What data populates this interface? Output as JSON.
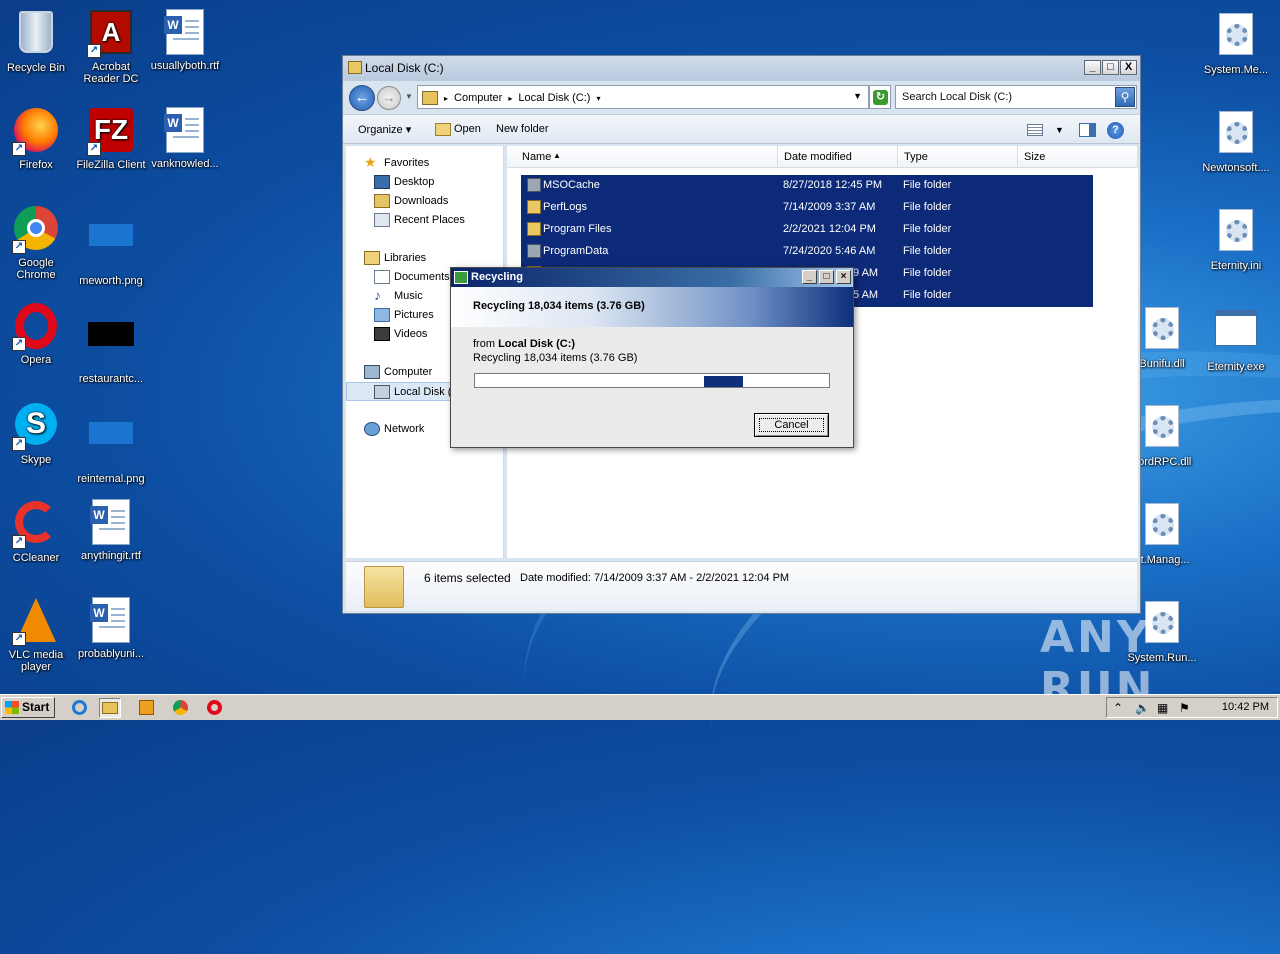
{
  "desktop": {
    "left_icons": [
      {
        "label": "Recycle Bin",
        "icon": "recycle-bin-icon"
      },
      {
        "label": "Acrobat\nReader DC",
        "icon": "acrobat-icon"
      },
      {
        "label": "usuallyboth.rtf",
        "icon": "word-doc-icon"
      },
      {
        "label": "Firefox",
        "icon": "firefox-icon"
      },
      {
        "label": "FileZilla Client",
        "icon": "filezilla-icon"
      },
      {
        "label": "vanknowled...",
        "icon": "word-doc-icon"
      },
      {
        "label": "Google\nChrome",
        "icon": "chrome-icon"
      },
      {
        "label": "meworth.png",
        "icon": "image-file-icon"
      },
      {
        "label": "Opera",
        "icon": "opera-icon"
      },
      {
        "label": "restaurantc...",
        "icon": "image-file-icon"
      },
      {
        "label": "Skype",
        "icon": "skype-icon"
      },
      {
        "label": "reinternal.png",
        "icon": "image-file-icon"
      },
      {
        "label": "CCleaner",
        "icon": "ccleaner-icon"
      },
      {
        "label": "anythingit.rtf",
        "icon": "word-doc-icon"
      },
      {
        "label": "VLC media\nplayer",
        "icon": "vlc-icon"
      },
      {
        "label": "probablyuni...",
        "icon": "word-doc-icon"
      }
    ],
    "right_icons": [
      {
        "label": "System.Me...",
        "icon": "settings-file-icon"
      },
      {
        "label": "Newtonsoft....",
        "icon": "settings-file-icon"
      },
      {
        "label": "Eternity.ini",
        "icon": "settings-file-icon"
      },
      {
        "label": "Bunifu.dll",
        "icon": "settings-file-icon"
      },
      {
        "label": "Eternity.exe",
        "icon": "app-window-icon"
      },
      {
        "label": "cordRPC.dll",
        "icon": "settings-file-icon"
      },
      {
        "label": "et.Manag...",
        "icon": "settings-file-icon"
      },
      {
        "label": "System.Run...",
        "icon": "settings-file-icon"
      }
    ],
    "watermark": "ANY RUN"
  },
  "explorer": {
    "title": "Local Disk (C:)",
    "window_buttons": {
      "minimize": "_",
      "maximize": "□",
      "close": "X"
    },
    "breadcrumbs": [
      "Computer",
      "Local Disk (C:)"
    ],
    "search_placeholder": "Search Local Disk (C:)",
    "toolbar": {
      "organize": "Organize",
      "open": "Open",
      "new_folder": "New folder"
    },
    "nav": {
      "favorites": "Favorites",
      "desktop": "Desktop",
      "downloads": "Downloads",
      "recent_places": "Recent Places",
      "libraries": "Libraries",
      "documents": "Documents",
      "music": "Music",
      "pictures": "Pictures",
      "videos": "Videos",
      "computer": "Computer",
      "local_disk": "Local Disk (",
      "network": "Network"
    },
    "columns": {
      "name": "Name",
      "date": "Date modified",
      "type": "Type",
      "size": "Size"
    },
    "rows": [
      {
        "name": "MSOCache",
        "date": "8/27/2018 12:45 PM",
        "type": "File folder"
      },
      {
        "name": "PerfLogs",
        "date": "7/14/2009 3:37 AM",
        "type": "File folder"
      },
      {
        "name": "Program Files",
        "date": "2/2/2021 12:04 PM",
        "type": "File folder"
      },
      {
        "name": "ProgramData",
        "date": "7/24/2020 5:46 AM",
        "type": "File folder"
      },
      {
        "name": "",
        "date": "9 AM",
        "type": "File folder"
      },
      {
        "name": "",
        "date": "5 AM",
        "type": "File folder"
      }
    ],
    "details": {
      "selected": "6 items selected",
      "date_label": "Date modified:",
      "date_range": "7/14/2009 3:37 AM - 2/2/2021 12:04 PM"
    }
  },
  "dialog": {
    "title": "Recycling",
    "heading": "Recycling 18,034 items (3.76 GB)",
    "from_prefix": "from",
    "from_location": "Local Disk (C:)",
    "sub": "Recycling 18,034 items (3.76 GB)",
    "cancel": "Cancel"
  },
  "taskbar": {
    "start": "Start",
    "clock": "10:42 PM"
  }
}
